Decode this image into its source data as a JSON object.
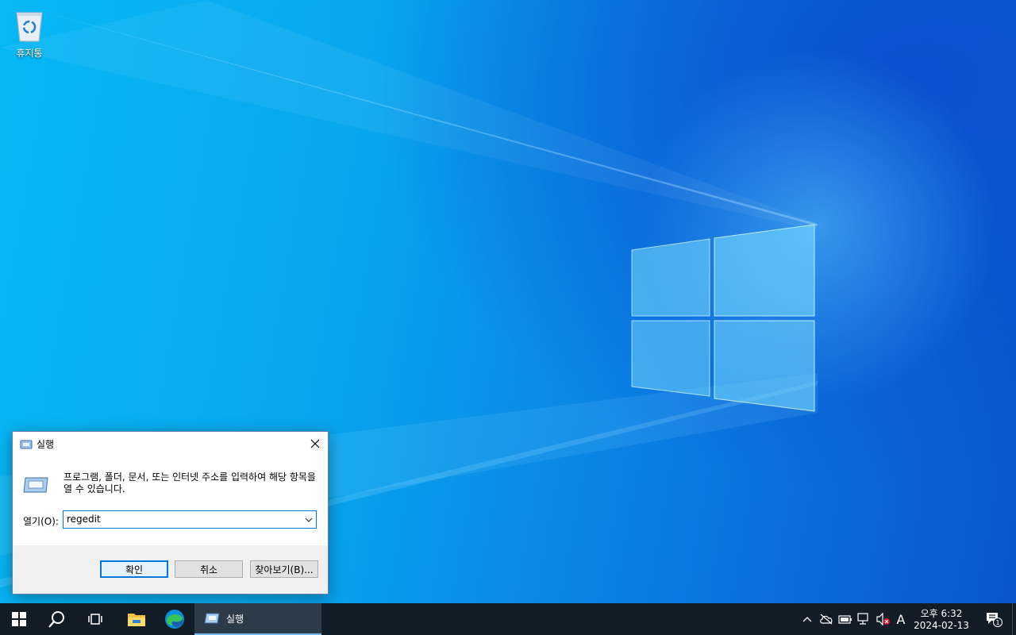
{
  "desktop": {
    "icons": [
      {
        "label": "휴지통",
        "icon": "recycle-bin-icon"
      }
    ]
  },
  "run_dialog": {
    "title": "실행",
    "description": "프로그램, 폴더, 문서, 또는 인터넷 주소를 입력하여 해당 항목을 열 수 있습니다.",
    "open_label": "열기(O):",
    "open_value": "regedit",
    "ok_label": "확인",
    "cancel_label": "취소",
    "browse_label": "찾아보기(B)...",
    "close_icon": "close-icon"
  },
  "taskbar": {
    "running_task_label": "실행",
    "ime_indicator": "A",
    "clock_time": "오후 6:32",
    "clock_date": "2024-02-13",
    "notification_count": "1",
    "accent_color": "#0078d7"
  }
}
